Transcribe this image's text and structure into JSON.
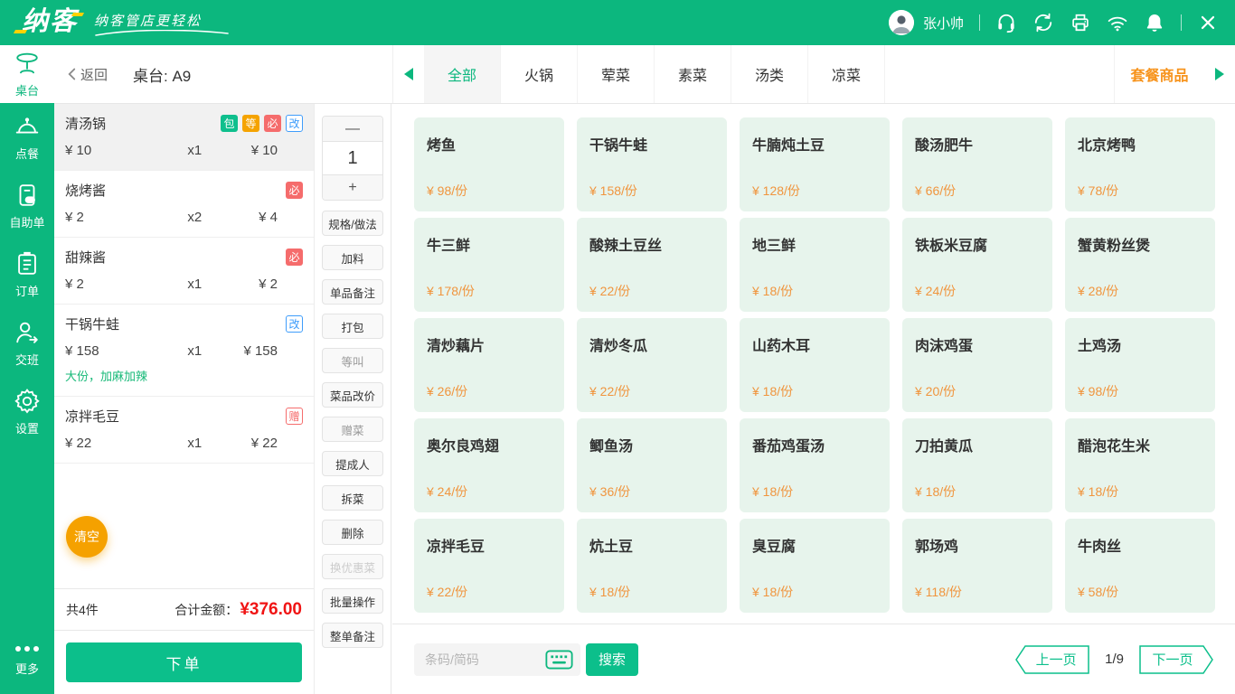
{
  "header": {
    "logo_text": "纳客",
    "slogan": "纳客管店更轻松",
    "user_name": "张小帅",
    "icons": [
      "avatar",
      "customer-service-icon",
      "sync-icon",
      "printer-icon",
      "wifi-icon",
      "bell-icon",
      "close-icon"
    ]
  },
  "sidebar": {
    "items": [
      {
        "label": "桌台",
        "icon": "table-icon",
        "key": "tables",
        "active": true
      },
      {
        "label": "点餐",
        "icon": "cloche-icon",
        "key": "ordering",
        "active": false
      },
      {
        "label": "自助单",
        "icon": "self-order-icon",
        "key": "self-order",
        "active": false
      },
      {
        "label": "订单",
        "icon": "order-list-icon",
        "key": "orders",
        "active": false
      },
      {
        "label": "交班",
        "icon": "shift-icon",
        "key": "shift",
        "active": false
      },
      {
        "label": "设置",
        "icon": "settings-icon",
        "key": "settings",
        "active": false
      }
    ],
    "more_label": "更多"
  },
  "topbar": {
    "back_label": "返回",
    "table_label": "桌台: A9",
    "categories": [
      "全部",
      "火锅",
      "荤菜",
      "素菜",
      "汤类",
      "凉菜"
    ],
    "active_category": "全部",
    "combo_label": "套餐商品"
  },
  "order": {
    "items": [
      {
        "name": "清汤锅",
        "badges": [
          {
            "text": "包",
            "style": "solid-green"
          },
          {
            "text": "等",
            "style": "solid-orange"
          },
          {
            "text": "必",
            "style": "solid-red"
          },
          {
            "text": "改",
            "style": "outline-blue"
          }
        ],
        "price": "¥ 10",
        "qty": "x1",
        "total": "¥ 10",
        "note": "",
        "selected": true
      },
      {
        "name": "烧烤酱",
        "badges": [
          {
            "text": "必",
            "style": "solid-red"
          }
        ],
        "price": "¥ 2",
        "qty": "x2",
        "total": "¥ 4",
        "note": "",
        "selected": false
      },
      {
        "name": "甜辣酱",
        "badges": [
          {
            "text": "必",
            "style": "solid-red"
          }
        ],
        "price": "¥ 2",
        "qty": "x1",
        "total": "¥ 2",
        "note": "",
        "selected": false
      },
      {
        "name": "干锅牛蛙",
        "badges": [
          {
            "text": "改",
            "style": "outline-blue"
          }
        ],
        "price": "¥ 158",
        "qty": "x1",
        "total": "¥ 158",
        "note": "大份，加麻加辣",
        "selected": false
      },
      {
        "name": "凉拌毛豆",
        "badges": [
          {
            "text": "赠",
            "style": "outline-red"
          }
        ],
        "price": "¥ 22",
        "qty": "x1",
        "total": "¥ 22",
        "note": "",
        "selected": false
      }
    ],
    "clear_label": "清空",
    "count_label": "共4件",
    "total_label": "合计金额：",
    "total_amount": "¥376.00",
    "submit_label": "下单"
  },
  "actions": {
    "minus_label": "—",
    "qty_value": "1",
    "plus_label": "+",
    "buttons": [
      {
        "label": "规格/做法",
        "state": "normal"
      },
      {
        "label": "加料",
        "state": "normal"
      },
      {
        "label": "单品备注",
        "state": "normal"
      },
      {
        "label": "打包",
        "state": "normal"
      },
      {
        "label": "等叫",
        "state": "muted"
      },
      {
        "label": "菜品改价",
        "state": "normal"
      },
      {
        "label": "赠菜",
        "state": "muted"
      },
      {
        "label": "提成人",
        "state": "normal"
      },
      {
        "label": "拆菜",
        "state": "normal"
      },
      {
        "label": "删除",
        "state": "normal"
      },
      {
        "label": "换优惠菜",
        "state": "disabled"
      },
      {
        "label": "批量操作",
        "state": "normal"
      },
      {
        "label": "整单备注",
        "state": "normal"
      }
    ]
  },
  "menu": {
    "items": [
      {
        "name": "烤鱼",
        "price": "¥ 98/份"
      },
      {
        "name": "干锅牛蛙",
        "price": "¥ 158/份"
      },
      {
        "name": "牛腩炖土豆",
        "price": "¥ 128/份"
      },
      {
        "name": "酸汤肥牛",
        "price": "¥ 66/份"
      },
      {
        "name": "北京烤鸭",
        "price": "¥ 78/份"
      },
      {
        "name": "牛三鲜",
        "price": "¥ 178/份"
      },
      {
        "name": "酸辣土豆丝",
        "price": "¥ 22/份"
      },
      {
        "name": "地三鲜",
        "price": "¥ 18/份"
      },
      {
        "name": "铁板米豆腐",
        "price": "¥ 24/份"
      },
      {
        "name": "蟹黄粉丝煲",
        "price": "¥ 28/份"
      },
      {
        "name": "清炒藕片",
        "price": "¥ 26/份"
      },
      {
        "name": "清炒冬瓜",
        "price": "¥ 22/份"
      },
      {
        "name": "山药木耳",
        "price": "¥ 18/份"
      },
      {
        "name": "肉沫鸡蛋",
        "price": "¥ 20/份"
      },
      {
        "name": "土鸡汤",
        "price": "¥ 98/份"
      },
      {
        "name": "奥尔良鸡翅",
        "price": "¥ 24/份"
      },
      {
        "name": "鲫鱼汤",
        "price": "¥ 36/份"
      },
      {
        "name": "番茄鸡蛋汤",
        "price": "¥ 18/份"
      },
      {
        "name": "刀拍黄瓜",
        "price": "¥ 18/份"
      },
      {
        "name": "醋泡花生米",
        "price": "¥ 18/份"
      },
      {
        "name": "凉拌毛豆",
        "price": "¥ 22/份"
      },
      {
        "name": "炕土豆",
        "price": "¥ 18/份"
      },
      {
        "name": "臭豆腐",
        "price": "¥ 18/份"
      },
      {
        "name": "郭场鸡",
        "price": "¥ 118/份"
      },
      {
        "name": "牛肉丝",
        "price": "¥ 58/份"
      }
    ]
  },
  "footer": {
    "search_placeholder": "条码/简码",
    "search_label": "搜索",
    "prev_label": "上一页",
    "page_indicator": "1/9",
    "next_label": "下一页"
  },
  "colors": {
    "brand_green": "#0CB77E",
    "button_green": "#0CBF8B",
    "price_orange": "#F0953E",
    "combo_orange": "#F7941E",
    "clear_orange": "#F5A100",
    "total_red": "#F01414",
    "badge_blue": "#3F9DFB",
    "badge_red": "#F56C6C",
    "badge_orange": "#F5A300",
    "note_green": "#17B978",
    "card_bg": "#E7F4EC"
  }
}
